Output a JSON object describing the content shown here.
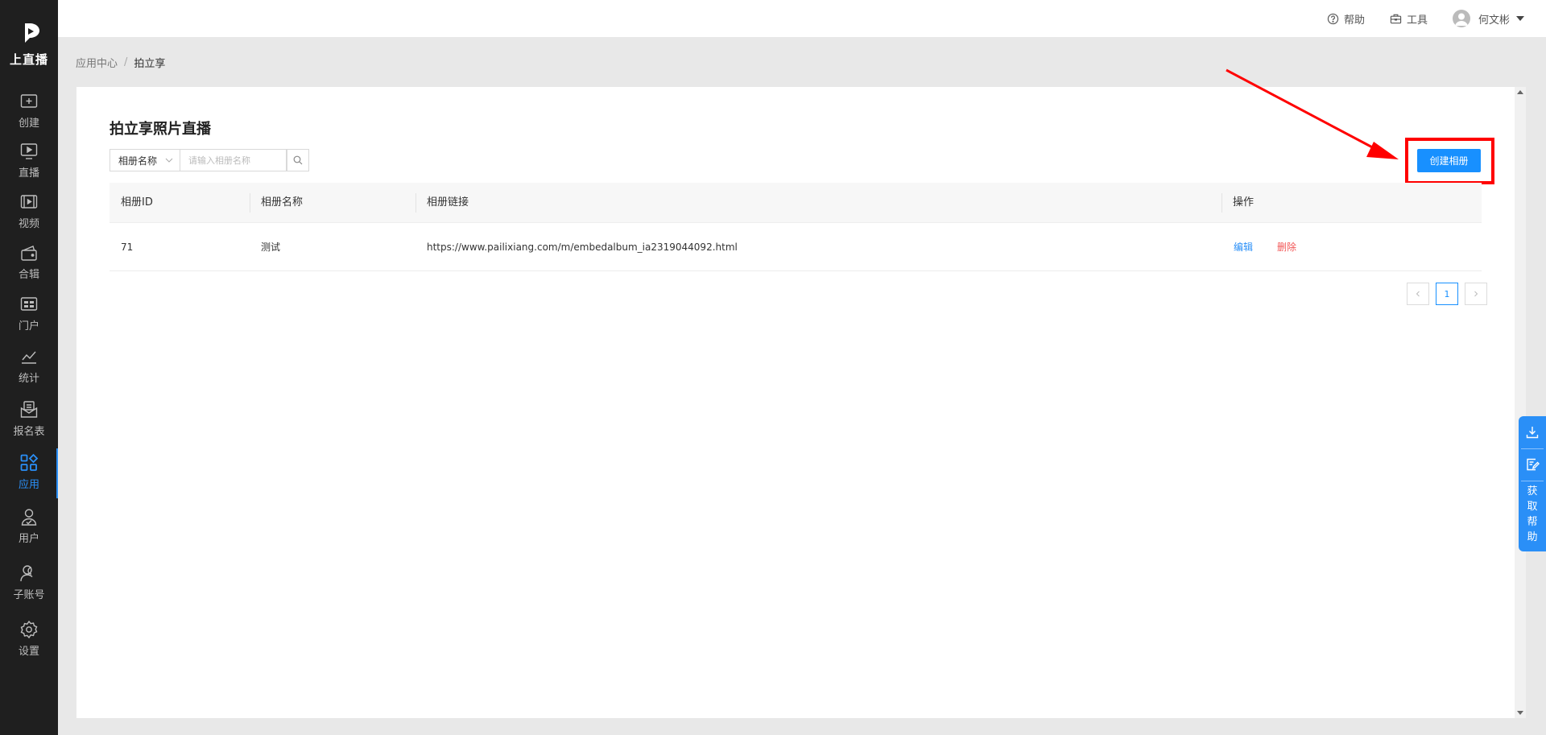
{
  "brand": {
    "name": "上直播"
  },
  "sidebar": {
    "items": [
      {
        "label": "创建",
        "icon": "plus-square-icon"
      },
      {
        "label": "直播",
        "icon": "play-monitor-icon"
      },
      {
        "label": "视频",
        "icon": "film-icon"
      },
      {
        "label": "合辑",
        "icon": "collection-icon"
      },
      {
        "label": "门户",
        "icon": "portal-icon"
      },
      {
        "label": "统计",
        "icon": "line-chart-icon"
      },
      {
        "label": "报名表",
        "icon": "form-inbox-icon"
      },
      {
        "label": "应用",
        "icon": "apps-grid-icon",
        "active": true
      },
      {
        "label": "用户",
        "icon": "user-check-icon"
      },
      {
        "label": "子账号",
        "icon": "sub-account-icon"
      },
      {
        "label": "设置",
        "icon": "gear-icon"
      }
    ]
  },
  "header": {
    "help_label": "帮助",
    "tools_label": "工具",
    "user_name": "何文彬"
  },
  "breadcrumb": {
    "parent": "应用中心",
    "separator": "/",
    "current": "拍立享"
  },
  "main": {
    "title": "拍立享照片直播",
    "filter": {
      "select_value": "相册名称",
      "search_placeholder": "请输入相册名称"
    },
    "create_button_label": "创建相册",
    "table": {
      "columns": [
        "相册ID",
        "相册名称",
        "相册链接",
        "操作"
      ],
      "rows": [
        {
          "id": "71",
          "name": "测试",
          "link": "https://www.pailixiang.com/m/embedalbum_ia2319044092.html",
          "edit_label": "编辑",
          "delete_label": "删除"
        }
      ]
    },
    "pagination": {
      "current_page": "1"
    }
  },
  "float_help": {
    "label": "获取帮助"
  },
  "colors": {
    "accent": "#1890ff",
    "sidebar_bg": "#1f1f1f",
    "delete": "#f25757",
    "annotation": "#ff0000"
  }
}
